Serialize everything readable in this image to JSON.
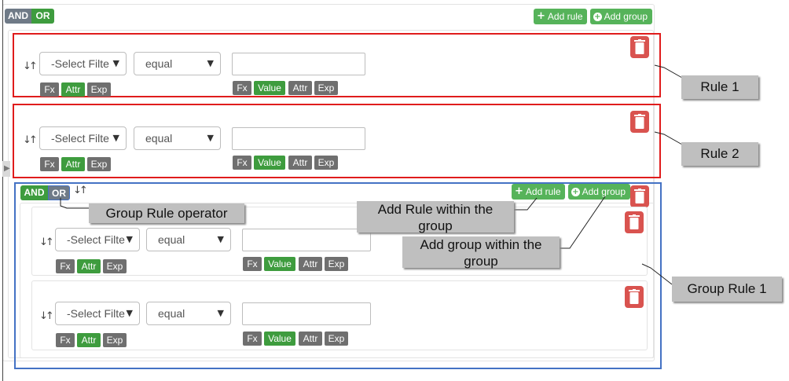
{
  "top": {
    "and_label": "AND",
    "or_label": "OR",
    "add_rule_label": "Add rule",
    "add_group_label": "Add group"
  },
  "rule_controls": {
    "filter_placeholder": "-Select Filte",
    "operator_value": "equal",
    "input_value": ""
  },
  "left_buttons": {
    "fx": "Fx",
    "attr": "Attr",
    "exp": "Exp"
  },
  "right_buttons": {
    "fx": "Fx",
    "value": "Value",
    "attr": "Attr",
    "exp": "Exp"
  },
  "group": {
    "and_label": "AND",
    "or_label": "OR",
    "add_rule_label": "Add rule",
    "add_group_label": "Add group"
  },
  "annotations": {
    "rule1": "Rule 1",
    "rule2": "Rule 2",
    "group_rule_operator": "Group Rule operator",
    "add_rule_within_group": "Add Rule within the group",
    "add_group_within_group": "Add group within the group",
    "group_rule1": "Group Rule 1"
  },
  "colors": {
    "annotation_red": "#e01c1c",
    "annotation_blue": "#4472c4",
    "add_green": "#56b35a",
    "dark_green": "#3e9c3e",
    "delete_red": "#d9534f",
    "badge_gray": "#6f6f6f"
  }
}
